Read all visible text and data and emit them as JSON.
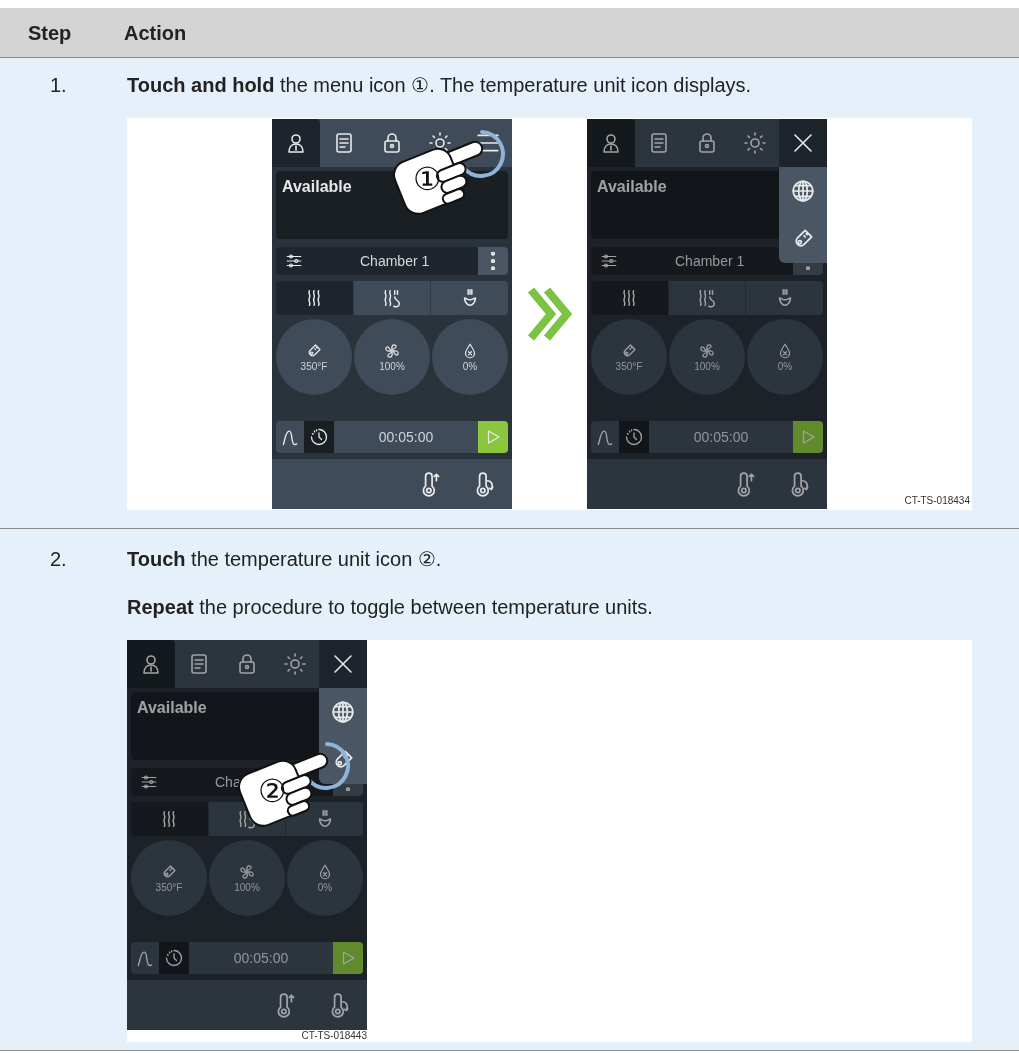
{
  "table": {
    "columns": [
      "Step",
      "Action"
    ],
    "rows": [
      {
        "step": "1.",
        "paragraphs": [
          "**Touch and hold** the menu icon ①. The temperature unit icon displays."
        ],
        "figure": {
          "caption": "CT-TS-018434",
          "items": [
            {
              "kind": "screen",
              "status": "Available",
              "chamber": "Chamber 1",
              "menu_open": false,
              "modes": [
                {
                  "selected": true
                },
                {
                  "selected": false
                },
                {
                  "selected": false
                }
              ],
              "readings": [
                "350°F",
                "100%",
                "0%"
              ],
              "timer": "00:05:00",
              "callout": {
                "label": "①"
              }
            },
            {
              "kind": "arrow"
            },
            {
              "kind": "screen",
              "status": "Available",
              "chamber": "Chamber 1",
              "menu_open": true,
              "modes": [
                {
                  "selected": true
                },
                {
                  "selected": false
                },
                {
                  "selected": false
                }
              ],
              "readings": [
                "350°F",
                "100%",
                "0%"
              ],
              "timer": "00:05:00"
            }
          ]
        }
      },
      {
        "step": "2.",
        "paragraphs": [
          "**Touch** the temperature unit icon ②.",
          "**Repeat** the procedure to toggle between temperature units."
        ],
        "figure": {
          "caption": "CT-TS-018443",
          "items": [
            {
              "kind": "screen",
              "status": "Available",
              "chamber": "Cha",
              "menu_open": true,
              "modes": [
                {
                  "selected": true
                },
                {
                  "selected": false
                },
                {
                  "selected": false
                }
              ],
              "readings": [
                "350°F",
                "100%",
                "0%"
              ],
              "timer": "00:05:00",
              "callout": {
                "label": "②"
              }
            }
          ]
        }
      }
    ]
  }
}
